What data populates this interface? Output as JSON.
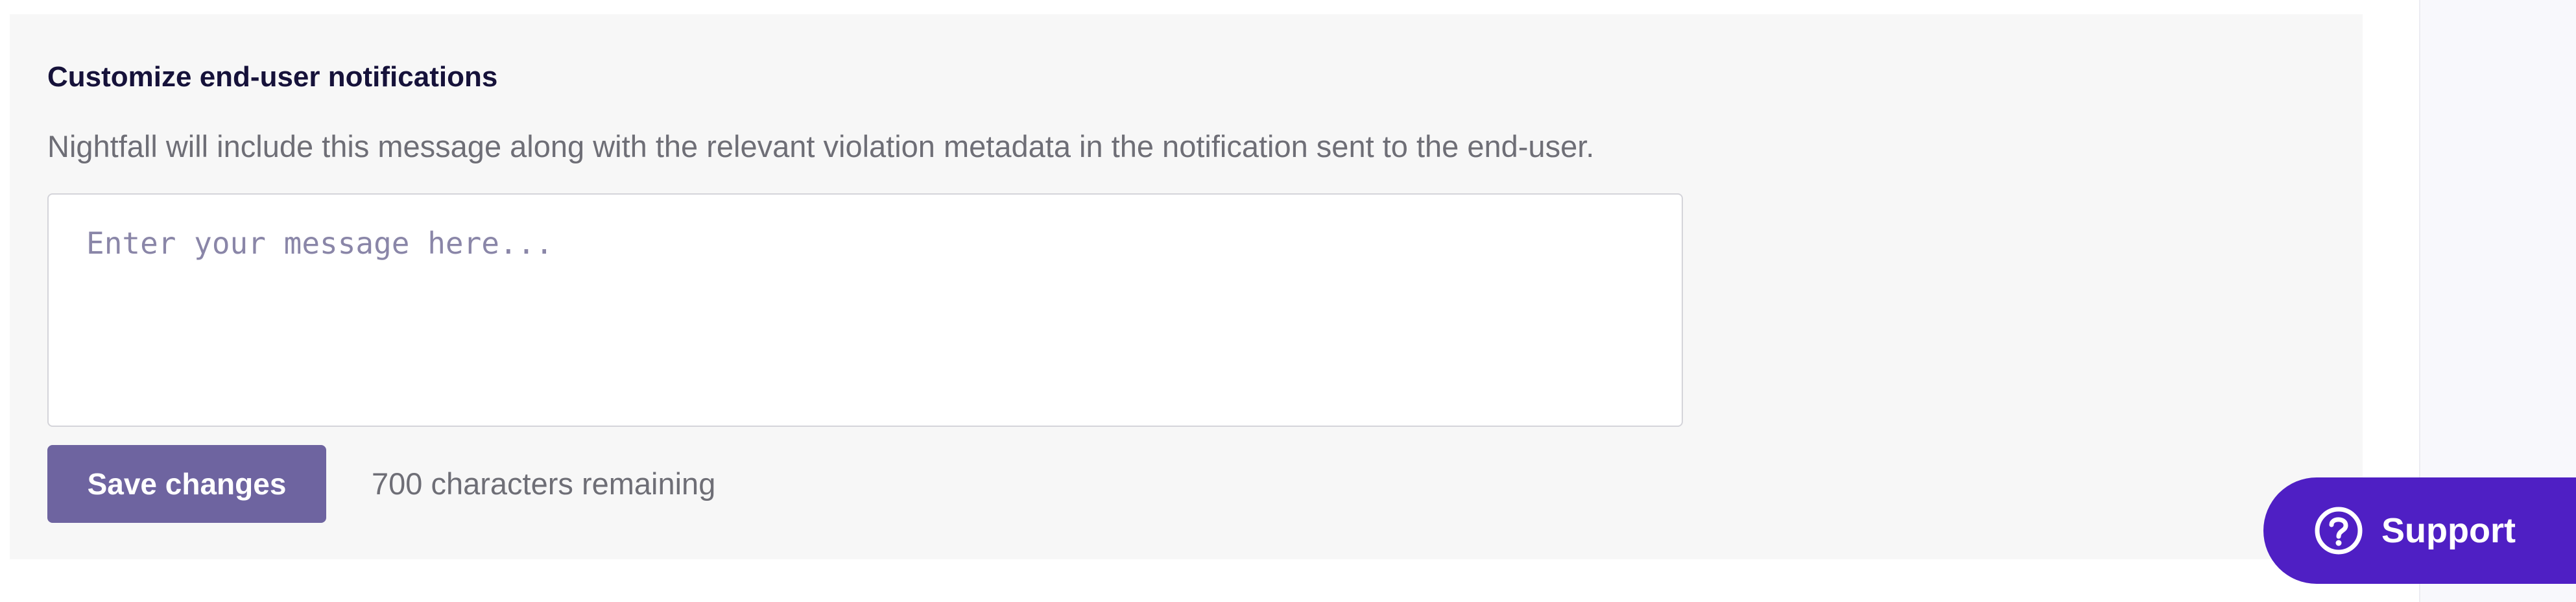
{
  "notifications": {
    "title": "Customize end-user notifications",
    "description": "Nightfall will include this message along with the relevant violation metadata in the notification sent to the end-user.",
    "message": {
      "placeholder": "Enter your message here...",
      "value": ""
    },
    "save_label": "Save changes",
    "remaining_text": "700 characters remaining"
  },
  "support": {
    "label": "Support",
    "icon": "help-circle-icon"
  },
  "colors": {
    "primary_button": "#6e64a0",
    "support_button": "#4f1fc4",
    "panel_background": "#f7f7f7",
    "title_text": "#16123a",
    "muted_text": "#6e6e76"
  }
}
